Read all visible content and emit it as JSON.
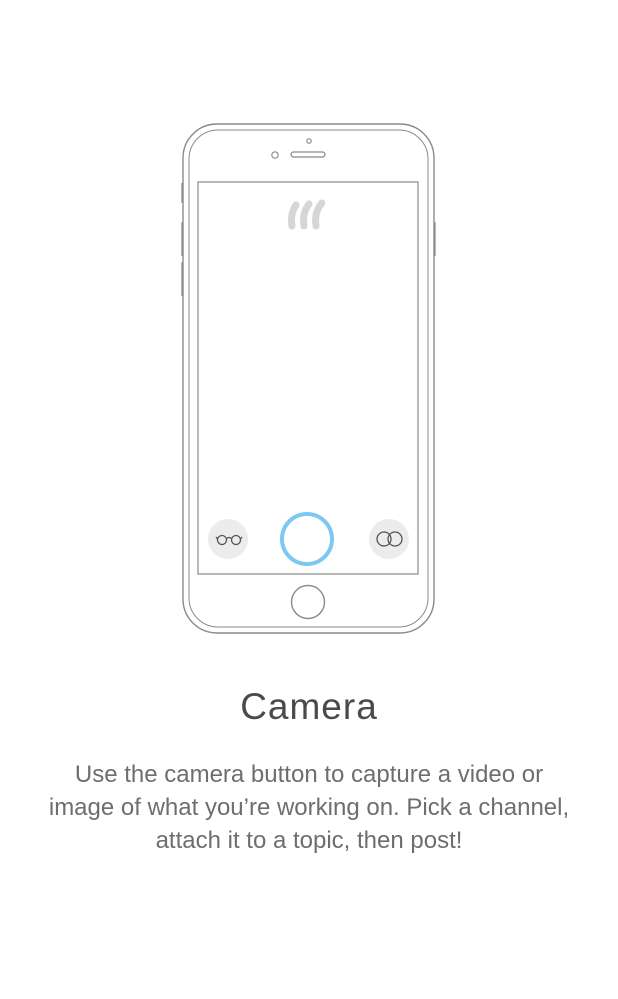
{
  "onboarding": {
    "title": "Camera",
    "description": "Use the camera button to capture a video or image of what you’re working on. Pick a channel, attach it to a topic, then post!"
  },
  "colors": {
    "accent": "#7cc8f2",
    "outline": "#8a8a8a",
    "logo": "#d6d6d6",
    "icon_bg": "#ececec"
  },
  "icons": {
    "left_control": "glasses-icon",
    "center_control": "capture-button",
    "right_control": "overlapping-circles-icon",
    "logo": "brand-logo-icon"
  }
}
